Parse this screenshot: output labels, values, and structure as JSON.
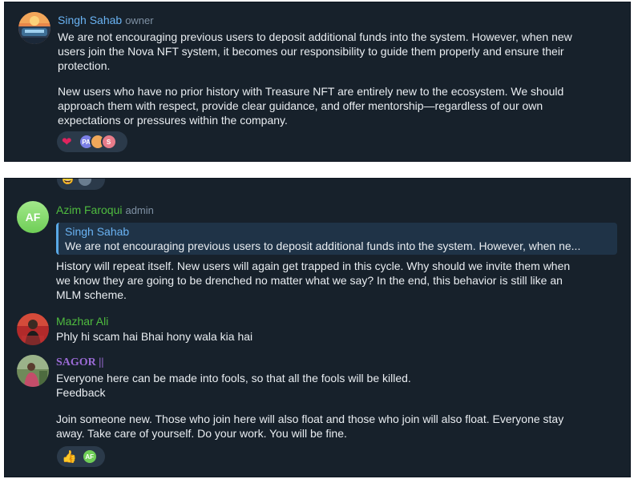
{
  "top_message": {
    "sender": "Singh Sahab",
    "role": "owner",
    "paragraph1": "We are not encouraging previous users to deposit additional funds into the system. However, when new\nusers join the Nova NFT system, it becomes our responsibility to guide them properly and ensure their\nprotection.",
    "paragraph2": "New users who have no prior history with Treasure NFT are entirely new to the ecosystem. We should\napproach them with respect, provide clear guidance, and offer mentorship—regardless of our own\nexpectations or pressures within the company.",
    "reactions": {
      "emoji": "❤️",
      "avatars": [
        "PA",
        "",
        "S"
      ]
    }
  },
  "messages": [
    {
      "sender": "Azim Faroqui",
      "role": "admin",
      "avatar_initials": "AF",
      "reply_to": {
        "sender": "Singh Sahab",
        "text": "We are not encouraging previous users to deposit additional funds into the system. However, when ne..."
      },
      "text": "History will repeat itself. New users will again get trapped in this cycle. Why should we invite them when\nwe know they are going to be drenched no matter what we say? In the end, this behavior is still like an\nMLM scheme."
    },
    {
      "sender": "Mazhar Ali",
      "text": "Phly hi scam hai Bhai hony wala kia hai"
    },
    {
      "sender": "SAGOR ||",
      "text": "Everyone here can be made into fools, so that all the fools will be killed.\nFeedback",
      "text2": "Join someone new. Those who join here will also float and those who join will also float. Everyone stay\naway. Take care of yourself. Do your work. You will be fine.",
      "reactions": {
        "emoji": "👍",
        "avatar": "AF"
      }
    }
  ],
  "colors": {
    "background": "#17212b",
    "text": "#e9edf1",
    "singh_name": "#6ab3f3",
    "azim_name": "#4fbc3f",
    "mazhar_name": "#4fbc3f",
    "sagor_name": "#9b6bd6"
  }
}
